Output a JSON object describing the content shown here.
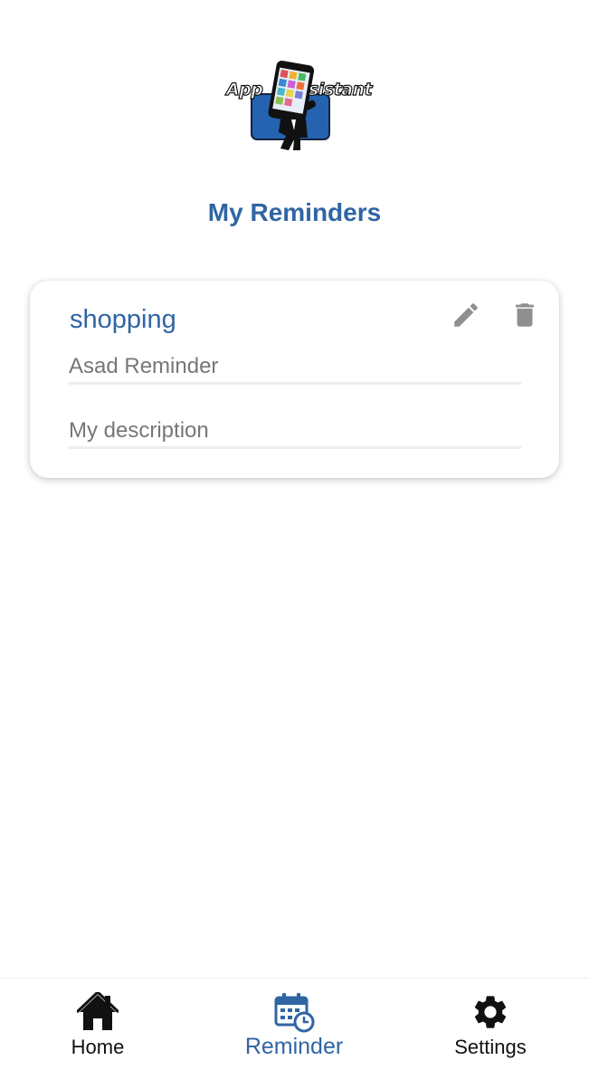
{
  "app": {
    "logo_text_left": "App",
    "logo_text_right": "sistant"
  },
  "page": {
    "title": "My Reminders"
  },
  "reminders": [
    {
      "title": "shopping",
      "name_value": "Asad Reminder",
      "description_value": "My description"
    }
  ],
  "icons": {
    "edit": "pencil-icon",
    "delete": "trash-icon",
    "home": "home-icon",
    "reminder": "calendar-clock-icon",
    "settings": "gear-icon"
  },
  "bottom_nav": {
    "items": [
      {
        "label": "Home",
        "active": false
      },
      {
        "label": "Reminder",
        "active": true
      },
      {
        "label": "Settings",
        "active": false
      }
    ]
  },
  "colors": {
    "accent": "#2f65a3",
    "icon_gray": "#8f8f8f",
    "text_gray": "#777777"
  }
}
